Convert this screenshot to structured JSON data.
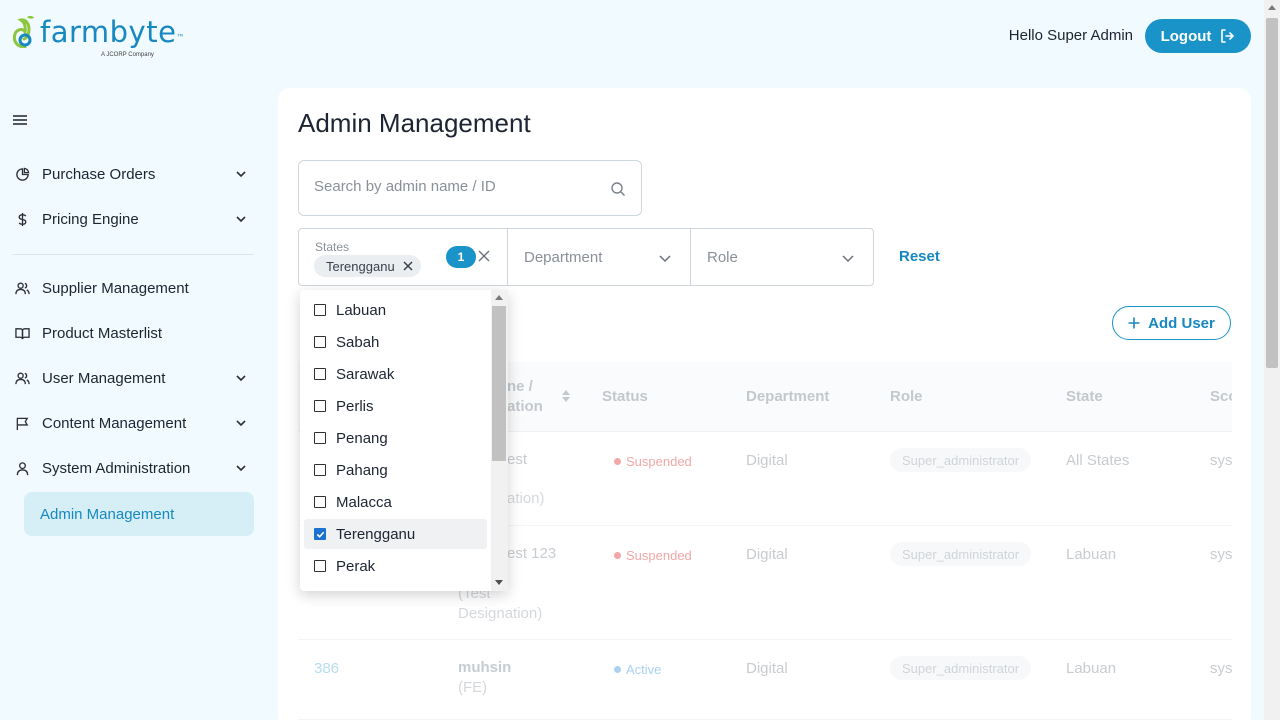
{
  "brand": {
    "name": "farmbyte",
    "trademark": "™",
    "subtitle": "A JCORP Company",
    "accent_color": "#1a93c9"
  },
  "header": {
    "greeting": "Hello Super Admin",
    "logout_label": "Logout"
  },
  "sidebar": {
    "items": [
      {
        "label": "Purchase Orders",
        "icon": "pie-chart-icon",
        "has_chevron": true
      },
      {
        "label": "Pricing Engine",
        "icon": "dollar-icon",
        "has_chevron": true
      },
      {
        "label": "Supplier Management",
        "icon": "users-icon",
        "has_chevron": false
      },
      {
        "label": "Product Masterlist",
        "icon": "book-icon",
        "has_chevron": false
      },
      {
        "label": "User Management",
        "icon": "users-icon",
        "has_chevron": true
      },
      {
        "label": "Content Management",
        "icon": "flag-icon",
        "has_chevron": true
      },
      {
        "label": "System Administration",
        "icon": "user-icon",
        "has_chevron": true
      }
    ],
    "active_sub_item": "Admin Management"
  },
  "main": {
    "title": "Admin Management",
    "search": {
      "placeholder": "Search by admin name / ID",
      "value": ""
    },
    "filters": {
      "states_label": "States",
      "selected_chip": "Terengganu",
      "selected_count": "1",
      "department_placeholder": "Department",
      "role_placeholder": "Role",
      "reset_label": "Reset"
    },
    "add_user_label": "Add User",
    "table": {
      "columns": {
        "name_line1": "ne /",
        "name_line2": "ation",
        "status": "Status",
        "department": "Department",
        "role": "Role",
        "state": "State",
        "scope": "Sco"
      },
      "rows": [
        {
          "id": "",
          "name": "est",
          "designation": "ation)",
          "designation2": "",
          "status": "Suspended",
          "status_color": "#f3a7a7",
          "department": "Digital",
          "role": "Super_administrator",
          "state": "All States",
          "scope": "sys"
        },
        {
          "id": "",
          "name": "est 123",
          "designation": "(Test",
          "designation2": "Designation)",
          "status": "Suspended",
          "status_color": "#f3a7a7",
          "department": "Digital",
          "role": "Super_administrator",
          "state": "Labuan",
          "scope": "sys"
        },
        {
          "id": "386",
          "name": "muhsin",
          "designation": "(FE)",
          "designation2": "",
          "status": "Active",
          "status_color": "#a9d2f0",
          "department": "Digital",
          "role": "Super_administrator",
          "state": "Labuan",
          "scope": "sys"
        }
      ]
    }
  },
  "states_dropdown": {
    "options": [
      {
        "label": "Labuan",
        "checked": false
      },
      {
        "label": "Sabah",
        "checked": false
      },
      {
        "label": "Sarawak",
        "checked": false
      },
      {
        "label": "Perlis",
        "checked": false
      },
      {
        "label": "Penang",
        "checked": false
      },
      {
        "label": "Pahang",
        "checked": false
      },
      {
        "label": "Malacca",
        "checked": false
      },
      {
        "label": "Terengganu",
        "checked": true
      },
      {
        "label": "Perak",
        "checked": false
      }
    ]
  }
}
